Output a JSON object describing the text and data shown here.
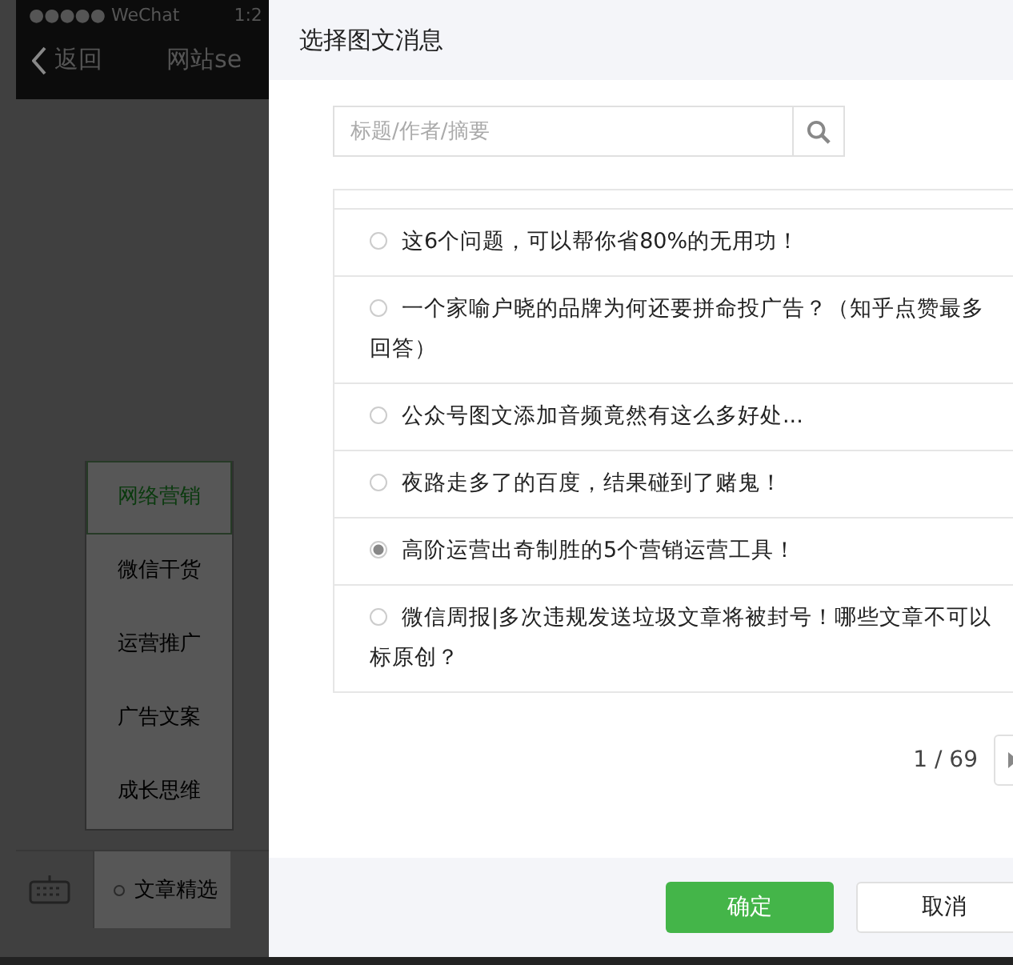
{
  "background_app": {
    "status_bar": {
      "carrier": "●●●●● WeChat",
      "time": "1:2"
    },
    "nav_bar": {
      "back": "返回",
      "title": "网站se"
    },
    "menu": [
      {
        "label": "网络营销",
        "selected": true
      },
      {
        "label": "微信干货",
        "selected": false
      },
      {
        "label": "运营推广",
        "selected": false
      },
      {
        "label": "广告文案",
        "selected": false
      },
      {
        "label": "成长思维",
        "selected": false
      }
    ],
    "bottom_bar": {
      "tab": "文章精选"
    }
  },
  "dialog": {
    "title": "选择图文消息",
    "search": {
      "placeholder": "标题/作者/摘要"
    },
    "articles": [
      {
        "title": "这6个问题，可以帮你省80%的无用功！",
        "selected": false
      },
      {
        "title": "一个家喻户晓的品牌为何还要拼命投广告？（知乎点赞最多回答）",
        "selected": false
      },
      {
        "title": "公众号图文添加音频竟然有这么多好处...",
        "selected": false
      },
      {
        "title": "夜路走多了的百度，结果碰到了赌鬼！",
        "selected": false
      },
      {
        "title": "高阶运营出奇制胜的5个营销运营工具！",
        "selected": true
      },
      {
        "title": "微信周报|多次违规发送垃圾文章将被封号！哪些文章不可以标原创？",
        "selected": false
      }
    ],
    "pager": "1 / 69",
    "buttons": [
      {
        "label": "确定",
        "kind": "primary"
      },
      {
        "label": "取消",
        "kind": "secondary"
      }
    ]
  }
}
